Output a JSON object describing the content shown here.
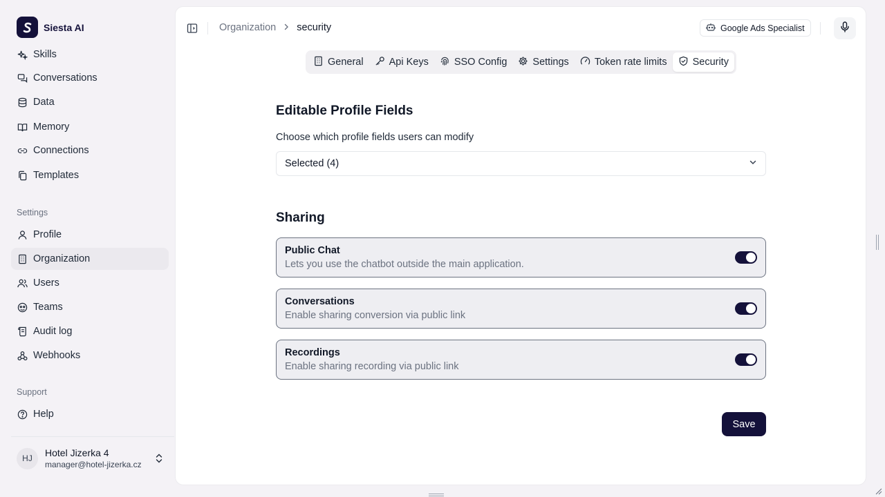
{
  "app": {
    "name": "Siesta AI"
  },
  "sidebar": {
    "items": [
      {
        "label": "Skills",
        "icon": "sparkles-icon"
      },
      {
        "label": "Conversations",
        "icon": "chat-bubbles-icon"
      },
      {
        "label": "Data",
        "icon": "database-icon"
      },
      {
        "label": "Memory",
        "icon": "book-open-icon"
      },
      {
        "label": "Connections",
        "icon": "link-icon"
      },
      {
        "label": "Templates",
        "icon": "copy-icon"
      }
    ],
    "settings_label": "Settings",
    "settings_items": [
      {
        "label": "Profile",
        "icon": "user-icon"
      },
      {
        "label": "Organization",
        "icon": "building-icon",
        "active": true
      },
      {
        "label": "Users",
        "icon": "users-icon"
      },
      {
        "label": "Teams",
        "icon": "teams-icon"
      },
      {
        "label": "Audit log",
        "icon": "scroll-icon"
      },
      {
        "label": "Webhooks",
        "icon": "webhook-icon"
      }
    ],
    "support_label": "Support",
    "support_items": [
      {
        "label": "Help",
        "icon": "help-circle-icon"
      }
    ],
    "user": {
      "initials": "HJ",
      "name": "Hotel Jizerka 4",
      "email": "manager@hotel-jizerka.cz"
    }
  },
  "header": {
    "breadcrumb": {
      "parent": "Organization",
      "current": "security"
    },
    "agent_chip": "Google Ads Specialist"
  },
  "tabs": [
    {
      "label": "General",
      "icon": "building-icon"
    },
    {
      "label": "Api Keys",
      "icon": "key-icon"
    },
    {
      "label": "SSO Config",
      "icon": "fingerprint-icon"
    },
    {
      "label": "Settings",
      "icon": "gear-icon"
    },
    {
      "label": "Token rate limits",
      "icon": "gauge-icon"
    },
    {
      "label": "Security",
      "icon": "shield-check-icon",
      "active": true
    }
  ],
  "profile_fields": {
    "title": "Editable Profile Fields",
    "description": "Choose which profile fields users can modify",
    "select_value": "Selected (4)"
  },
  "sharing": {
    "title": "Sharing",
    "items": [
      {
        "title": "Public Chat",
        "description": "Lets you use the chatbot outside the main application.",
        "enabled": true
      },
      {
        "title": "Conversations",
        "description": "Enable sharing conversion via public link",
        "enabled": true
      },
      {
        "title": "Recordings",
        "description": "Enable sharing recording via public link",
        "enabled": true
      }
    ]
  },
  "actions": {
    "save_label": "Save"
  },
  "colors": {
    "accent": "#14113a",
    "sidebar_bg": "#f4f2f6",
    "card_bg": "#eeeef2"
  }
}
